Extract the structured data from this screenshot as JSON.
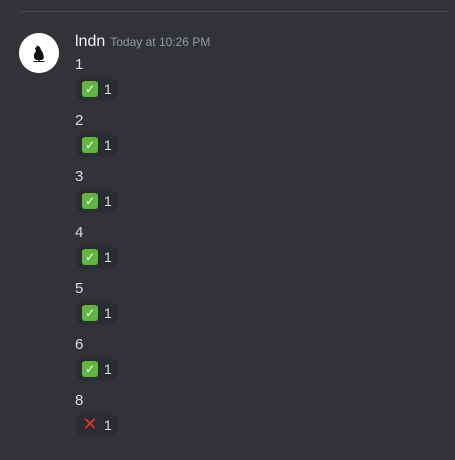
{
  "message": {
    "author": "lndn",
    "timestamp": "Today at 10:26 PM",
    "avatar_icon": "raven-silhouette-icon",
    "lines": [
      {
        "text": "1",
        "reaction": {
          "emoji": "✅",
          "icon": "check-mark-button-icon",
          "count": "1"
        }
      },
      {
        "text": "2",
        "reaction": {
          "emoji": "✅",
          "icon": "check-mark-button-icon",
          "count": "1"
        }
      },
      {
        "text": "3",
        "reaction": {
          "emoji": "✅",
          "icon": "check-mark-button-icon",
          "count": "1"
        }
      },
      {
        "text": "4",
        "reaction": {
          "emoji": "✅",
          "icon": "check-mark-button-icon",
          "count": "1"
        }
      },
      {
        "text": "5",
        "reaction": {
          "emoji": "✅",
          "icon": "check-mark-button-icon",
          "count": "1"
        }
      },
      {
        "text": "6",
        "reaction": {
          "emoji": "✅",
          "icon": "check-mark-button-icon",
          "count": "1"
        }
      },
      {
        "text": "8",
        "reaction": {
          "emoji": "❌",
          "icon": "cross-mark-icon",
          "count": "1"
        }
      }
    ]
  },
  "colors": {
    "background": "#313338",
    "reaction_bg": "#2b2d31",
    "check_green": "#5fb83d",
    "cross_red": "#e2342a"
  }
}
